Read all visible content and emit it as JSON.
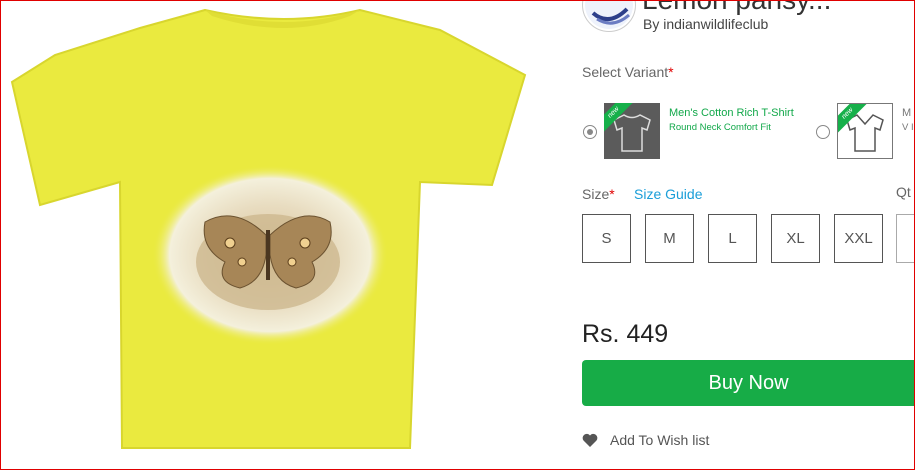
{
  "product": {
    "title": "Lemon pansy...",
    "byline": "By indianwildlifeclub"
  },
  "variant": {
    "label": "Select Variant",
    "required_mark": "*",
    "options": [
      {
        "name": "Men's Cotton Rich T-Shirt",
        "sub": "Round Neck Comfort Fit",
        "badge": "new",
        "selected": true
      },
      {
        "name": "M",
        "sub": "V I",
        "badge": "new",
        "selected": false
      }
    ]
  },
  "size": {
    "label": "Size",
    "required_mark": "*",
    "guide_label": "Size Guide",
    "options": [
      "S",
      "M",
      "L",
      "XL",
      "XXL"
    ]
  },
  "quantity": {
    "label": "Qt"
  },
  "price": "Rs. 449",
  "buy_button": "Buy Now",
  "wishlist_label": "Add To Wish list",
  "colors": {
    "accent": "#17ac47",
    "link": "#1a9ed8",
    "shirt": "#eaea3f",
    "required": "#e00000"
  }
}
